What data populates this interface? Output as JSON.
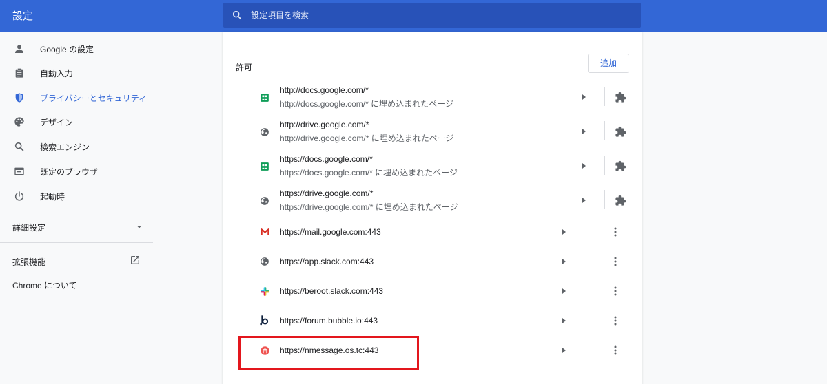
{
  "header": {
    "title": "設定",
    "search_placeholder": "設定項目を検索"
  },
  "sidebar": {
    "items": [
      {
        "label": "Google の設定",
        "icon": "person-icon"
      },
      {
        "label": "自動入力",
        "icon": "clipboard-icon"
      },
      {
        "label": "プライバシーとセキュリティ",
        "icon": "shield-icon",
        "active": true
      },
      {
        "label": "デザイン",
        "icon": "palette-icon"
      },
      {
        "label": "検索エンジン",
        "icon": "search-icon"
      },
      {
        "label": "既定のブラウザ",
        "icon": "browser-icon"
      },
      {
        "label": "起動時",
        "icon": "power-icon"
      }
    ],
    "advanced_label": "詳細設定",
    "extensions_label": "拡張機能",
    "about_label": "Chrome について"
  },
  "main": {
    "section_label": "許可",
    "add_button": "追加",
    "rows": [
      {
        "line1": "http://docs.google.com/*",
        "line2": "http://docs.google.com/* に埋め込まれたページ",
        "icon": "sheets-icon",
        "action_icon": "puzzle-icon"
      },
      {
        "line1": "http://drive.google.com/*",
        "line2": "http://drive.google.com/* に埋め込まれたページ",
        "icon": "globe-icon",
        "action_icon": "puzzle-icon"
      },
      {
        "line1": "https://docs.google.com/*",
        "line2": "https://docs.google.com/* に埋め込まれたページ",
        "icon": "sheets-icon",
        "action_icon": "puzzle-icon"
      },
      {
        "line1": "https://drive.google.com/*",
        "line2": "https://drive.google.com/* に埋め込まれたページ",
        "icon": "globe-icon",
        "action_icon": "puzzle-icon"
      },
      {
        "line1": "https://mail.google.com:443",
        "icon": "gmail-icon",
        "action_icon": "more-vert-icon"
      },
      {
        "line1": "https://app.slack.com:443",
        "icon": "globe-icon",
        "action_icon": "more-vert-icon"
      },
      {
        "line1": "https://beroot.slack.com:443",
        "icon": "slack-icon",
        "action_icon": "more-vert-icon"
      },
      {
        "line1": "https://forum.bubble.io:443",
        "icon": "bubble-icon",
        "action_icon": "more-vert-icon"
      },
      {
        "line1": "https://nmessage.os.tc:443",
        "icon": "nmessage-icon",
        "action_icon": "more-vert-icon"
      }
    ]
  },
  "colors": {
    "header_bg": "#3367d6",
    "search_bg": "#2852b8",
    "accent": "#3367d6",
    "highlight": "#e3161d"
  }
}
